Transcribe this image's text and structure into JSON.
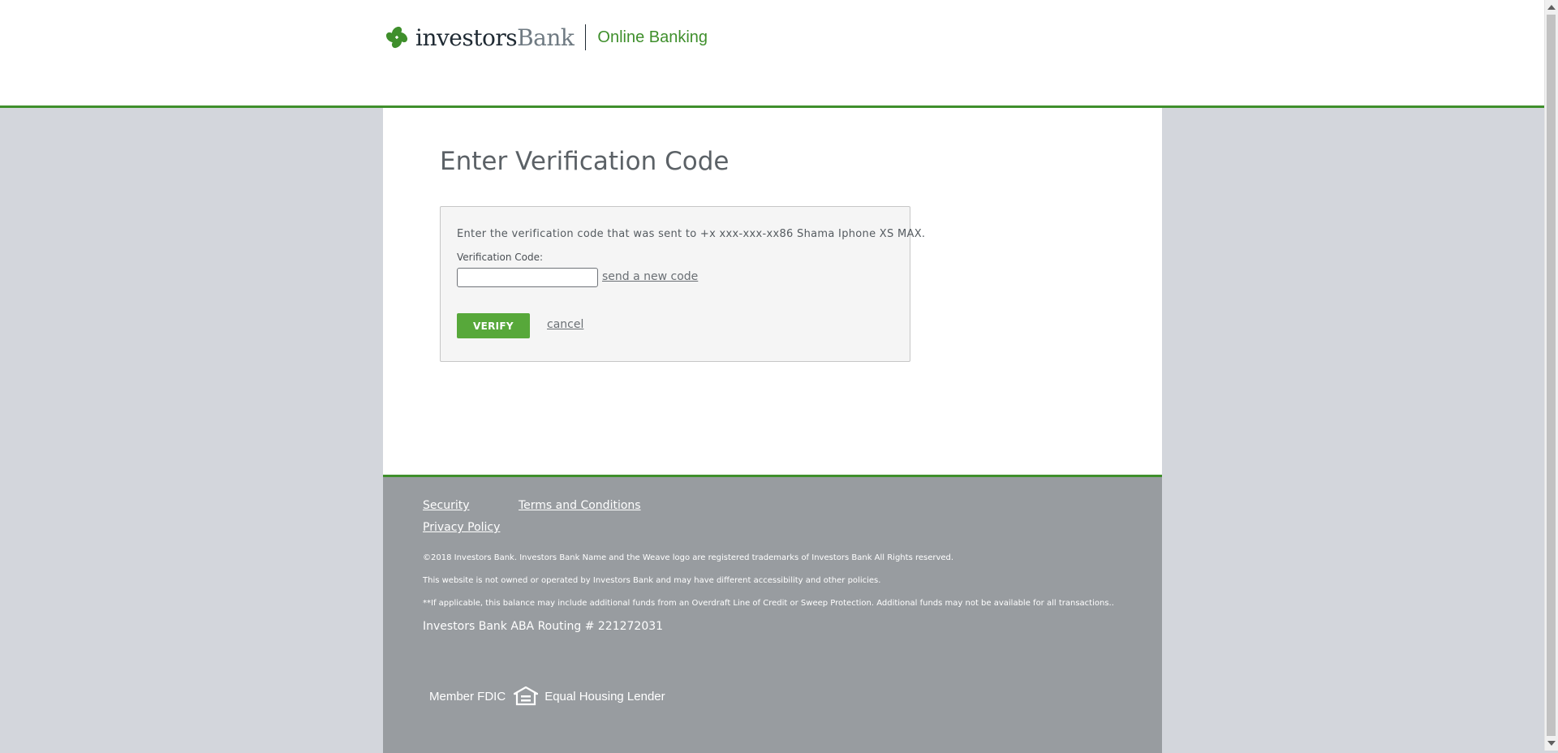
{
  "header": {
    "logo_name_part1": "investors",
    "logo_name_part2": "Bank",
    "logo_subtitle": "Online Banking"
  },
  "main": {
    "title": "Enter Verification Code",
    "instruction": "Enter the verification code that was sent to +x xxx-xxx-xx86 Shama Iphone XS MAX.",
    "code_label": "Verification Code:",
    "code_value": "",
    "send_new_code_label": "send a new code",
    "verify_label": "VERIFY",
    "cancel_label": "cancel"
  },
  "footer": {
    "links": {
      "security": "Security",
      "terms": "Terms and Conditions",
      "privacy": "Privacy Policy"
    },
    "copyright": "©2018 Investors Bank. Investors Bank Name and the Weave logo are registered trademarks of Investors Bank All Rights reserved.",
    "not_owned": "This website is not owned or operated by Investors Bank and may have different accessibility and other policies.",
    "balance_note": "**If applicable, this balance may include additional funds from an Overdraft Line of Credit or Sweep Protection. Additional funds may not be available for all transactions..",
    "routing": "Investors Bank ABA Routing # 221272031",
    "member_fdic": "Member FDIC",
    "equal_housing": "Equal Housing Lender"
  },
  "colors": {
    "brand_green": "#3f8f2c",
    "button_green": "#57a83a",
    "footer_gray": "#989ca0",
    "page_bg": "#d3d6dc"
  },
  "icons": [
    "clover-logo-icon",
    "equal-housing-icon"
  ]
}
